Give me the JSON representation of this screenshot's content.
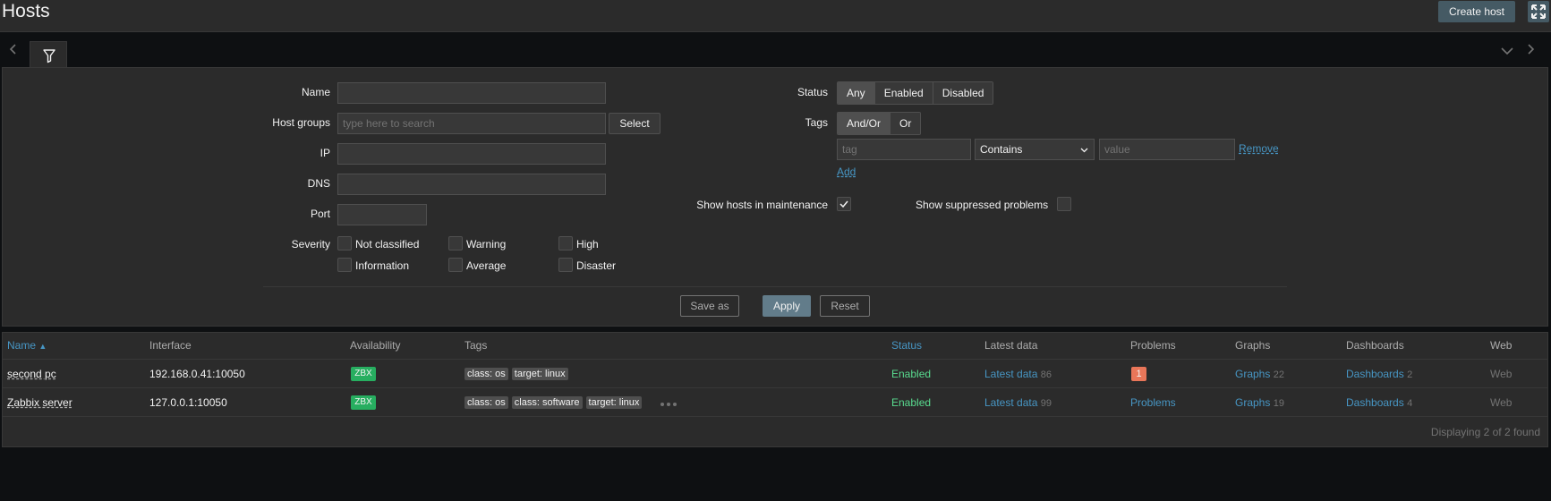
{
  "page": {
    "title": "Hosts",
    "create_host_label": "Create host"
  },
  "filter": {
    "name_label": "Name",
    "name_value": "",
    "host_groups_label": "Host groups",
    "host_groups_placeholder": "type here to search",
    "select_label": "Select",
    "ip_label": "IP",
    "dns_label": "DNS",
    "port_label": "Port",
    "severity_label": "Severity",
    "severities": [
      "Not classified",
      "Warning",
      "High",
      "Information",
      "Average",
      "Disaster"
    ],
    "status_label": "Status",
    "status_options": [
      "Any",
      "Enabled",
      "Disabled"
    ],
    "status_selected": "Any",
    "tags_label": "Tags",
    "tags_options": [
      "And/Or",
      "Or"
    ],
    "tags_selected": "And/Or",
    "tag_placeholder": "tag",
    "tag_operator": "Contains",
    "value_placeholder": "value",
    "remove_label": "Remove",
    "add_label": "Add",
    "maintenance_label": "Show hosts in maintenance",
    "maintenance_checked": true,
    "suppressed_label": "Show suppressed problems",
    "suppressed_checked": false,
    "save_as_label": "Save as",
    "apply_label": "Apply",
    "reset_label": "Reset"
  },
  "table": {
    "columns": [
      "Name",
      "Interface",
      "Availability",
      "Tags",
      "Status",
      "Latest data",
      "Problems",
      "Graphs",
      "Dashboards",
      "Web"
    ],
    "sort_indicator": "▲",
    "rows": [
      {
        "name": "second pc",
        "interface": "192.168.0.41:10050",
        "availability": "ZBX",
        "tags": [
          "class: os",
          "target: linux"
        ],
        "status": "Enabled",
        "latest_label": "Latest data",
        "latest_count": "86",
        "problems_badge": "1",
        "problems_text": "",
        "graphs_label": "Graphs",
        "graphs_count": "22",
        "dashboards_label": "Dashboards",
        "dashboards_count": "2",
        "web": "Web"
      },
      {
        "name": "Zabbix server",
        "interface": "127.0.0.1:10050",
        "availability": "ZBX",
        "tags": [
          "class: os",
          "class: software",
          "target: linux"
        ],
        "status": "Enabled",
        "latest_label": "Latest data",
        "latest_count": "99",
        "problems_badge": "",
        "problems_text": "Problems",
        "graphs_label": "Graphs",
        "graphs_count": "19",
        "dashboards_label": "Dashboards",
        "dashboards_count": "4",
        "web": "Web"
      }
    ],
    "footer": "Displaying 2 of 2 found"
  },
  "colors": {
    "accent": "#4796c4",
    "enabled": "#59db8f",
    "zbx": "#27ae60",
    "problem": "#e97659"
  }
}
